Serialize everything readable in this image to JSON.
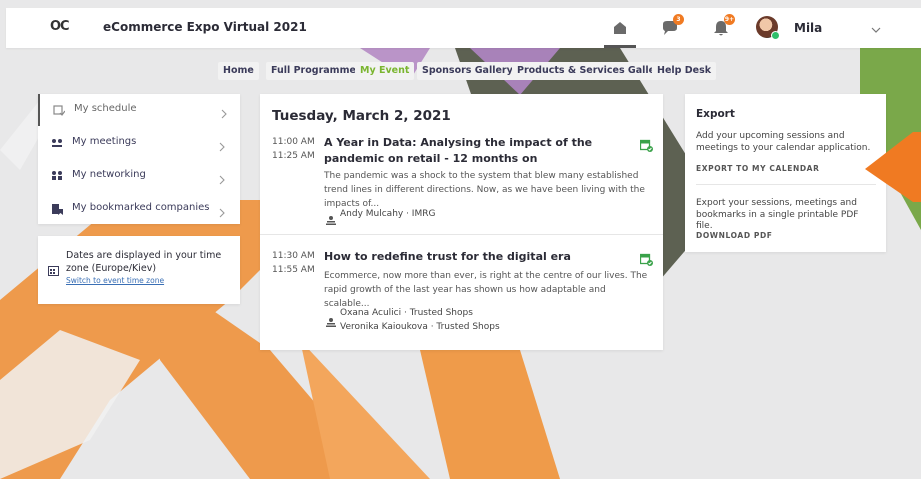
{
  "app": {
    "title": "eCommerce Expo Virtual 2021",
    "logo": "OC"
  },
  "header": {
    "chat_badge": "3",
    "bell_badge": "9+",
    "user_name": "Mila"
  },
  "nav": {
    "items": [
      {
        "label": "Home",
        "active": false
      },
      {
        "label": "Full Programme",
        "active": false
      },
      {
        "label": "My Event",
        "active": true
      },
      {
        "label": "Sponsors Gallery",
        "active": false
      },
      {
        "label": "Products & Services Gallery",
        "active": false
      },
      {
        "label": "Help Desk",
        "active": false
      }
    ]
  },
  "sidebar": {
    "items": [
      {
        "label": "My schedule",
        "icon": "calendar-check-icon"
      },
      {
        "label": "My meetings",
        "icon": "meetings-icon"
      },
      {
        "label": "My networking",
        "icon": "people-icon"
      },
      {
        "label": "My bookmarked companies",
        "icon": "bookmark-building-icon"
      }
    ]
  },
  "timezone": {
    "text": "Dates are displayed in your time zone (Europe/Kiev)",
    "link": "Switch to event time zone"
  },
  "schedule": {
    "day": "Tuesday, March 2, 2021",
    "sessions": [
      {
        "start": "11:00 AM",
        "end": "11:25 AM",
        "title": "A Year in Data: Analysing the impact of the pandemic on retail - 12 months on",
        "description": "The pandemic was a shock to the system that blew many established trend lines in different directions. Now, as we have been living with the impacts of...",
        "speakers": [
          "Andy Mulcahy · IMRG"
        ]
      },
      {
        "start": "11:30 AM",
        "end": "11:55 AM",
        "title": "How to redefine trust for the digital era",
        "description": "Ecommerce, now more than ever, is right at the centre of our lives. The rapid growth of the last year has shown us how adaptable and scalable...",
        "speakers": [
          "Oxana Aculici · Trusted Shops",
          "Veronika Kaioukova · Trusted Shops"
        ]
      }
    ]
  },
  "export": {
    "title": "Export",
    "calendar_text": "Add your upcoming sessions and meetings to your calendar application.",
    "calendar_link": "EXPORT TO MY CALENDAR",
    "pdf_text": "Export your sessions, meetings and bookmarks in a single printable PDF file.",
    "pdf_link": "DOWNLOAD PDF"
  },
  "colors": {
    "accent_green": "#7ab52f",
    "orange": "#f07a22",
    "calendar_green": "#3aa24a"
  }
}
